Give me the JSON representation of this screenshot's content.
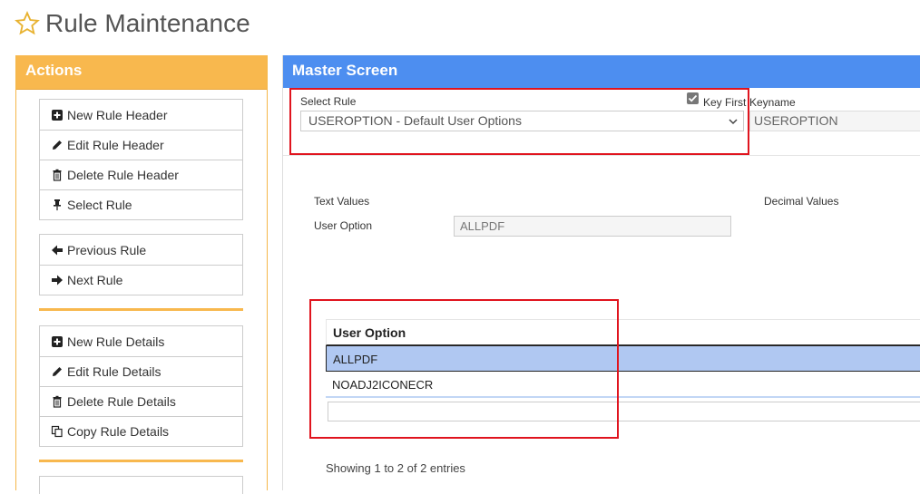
{
  "page": {
    "title": "Rule Maintenance"
  },
  "actions": {
    "header": "Actions",
    "group1": [
      "New Rule Header",
      "Edit Rule Header",
      "Delete Rule Header",
      "Select Rule"
    ],
    "group2": [
      "Previous Rule",
      "Next Rule"
    ],
    "group3": [
      "New Rule Details",
      "Edit Rule Details",
      "Delete Rule Details",
      "Copy Rule Details"
    ]
  },
  "master": {
    "header": "Master Screen",
    "select_rule_label": "Select Rule",
    "select_rule_value": "USEROPTION - Default User Options",
    "key_first_label": "Key First",
    "keyname_label": "Keyname",
    "keyname_value": "USEROPTION",
    "text_values_label": "Text Values",
    "decimal_values_label": "Decimal Values",
    "user_option_label": "User Option",
    "user_option_value": "ALLPDF"
  },
  "table": {
    "header": "User Option",
    "rows": [
      "ALLPDF",
      "NOADJ2ICONECR"
    ],
    "showing": "Showing 1 to 2 of 2 entries"
  },
  "colors": {
    "actions_accent": "#f8b84e",
    "master_accent": "#4d8ef0",
    "selected_row": "#b0c8f2",
    "highlight_box": "#e0141e"
  }
}
